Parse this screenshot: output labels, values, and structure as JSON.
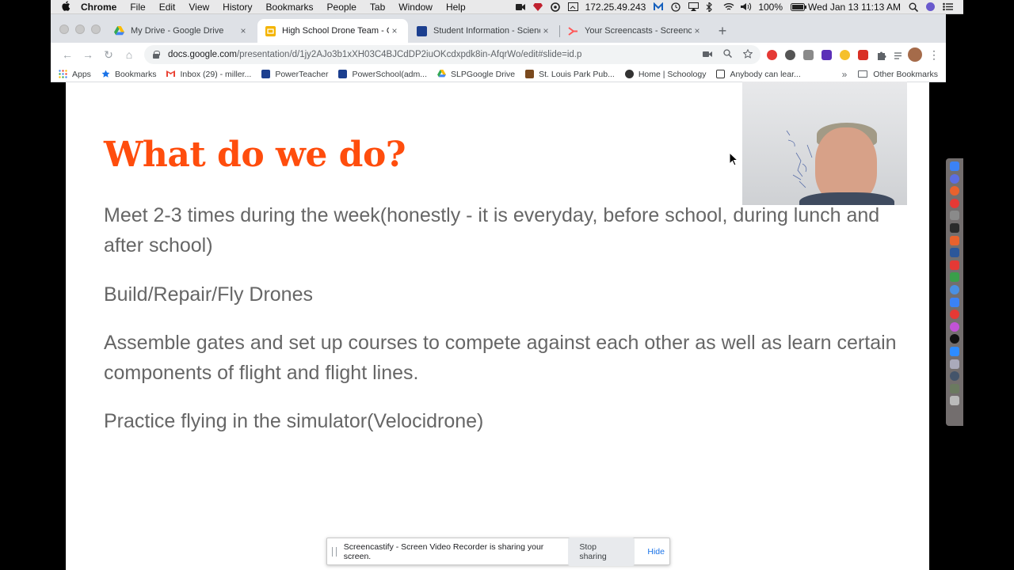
{
  "menubar": {
    "apple_icon": "",
    "app_name": "Chrome",
    "items": [
      "File",
      "Edit",
      "View",
      "History",
      "Bookmarks",
      "People",
      "Tab",
      "Window",
      "Help"
    ],
    "ip": "172.25.49.243",
    "battery": "100%",
    "datetime": "Wed Jan 13  11:13 AM"
  },
  "tabs": [
    {
      "title": "My Drive - Google Drive",
      "icon": "google-drive-icon",
      "close": "×"
    },
    {
      "title": "High School Drone Team - Goo",
      "icon": "google-slides-icon",
      "close": "×"
    },
    {
      "title": "Student Information - Science",
      "icon": "sis-icon",
      "close": "×"
    },
    {
      "title": "Your Screencasts - Screencasti",
      "icon": "screencastify-icon",
      "close": "×"
    }
  ],
  "new_tab": "+",
  "toolbar": {
    "back": "←",
    "forward": "→",
    "reload": "↻",
    "home": "⌂",
    "url_host": "docs.google.com",
    "url_path": "/presentation/d/1jy2AJo3b1xXH03C4BJCdDP2iuOKcdxpdk8in-AfqrWo/edit#slide=id.p",
    "kebab": "⋮"
  },
  "bookmarks": [
    {
      "label": "Apps",
      "icon": "apps-grid-icon"
    },
    {
      "label": "Bookmarks",
      "icon": "star-icon"
    },
    {
      "label": "Inbox (29) - miller...",
      "icon": "gmail-icon"
    },
    {
      "label": "PowerTeacher",
      "icon": "sis-icon"
    },
    {
      "label": "PowerSchool(adm...",
      "icon": "sis-icon"
    },
    {
      "label": "SLPGoogle Drive",
      "icon": "google-drive-icon"
    },
    {
      "label": "St. Louis Park Pub...",
      "icon": "school-crest-icon"
    },
    {
      "label": "Home | Schoology",
      "icon": "schoology-icon"
    },
    {
      "label": "Anybody can lear...",
      "icon": "code-org-icon"
    }
  ],
  "bookmarks_more": "»",
  "other_bookmarks": "Other Bookmarks",
  "slide": {
    "title": "What do we do?",
    "bullets": [
      "Meet 2-3 times during the week(honestly - it is everyday, before school, during lunch and after school)",
      "Build/Repair/Fly Drones",
      "Assemble gates and set up courses to compete against each other as well as learn certain components of flight and flight lines.",
      "Practice flying in the simulator(Velocidrone)"
    ]
  },
  "sharebar": {
    "message": "Screencastify - Screen Video Recorder is sharing your screen.",
    "stop_label": "Stop sharing",
    "hide_label": "Hide"
  },
  "colors": {
    "title_orange": "#ff4d0d",
    "bullet_gray": "#666666",
    "tab_strip": "#dee1e6",
    "link_blue": "#1a73e8"
  }
}
